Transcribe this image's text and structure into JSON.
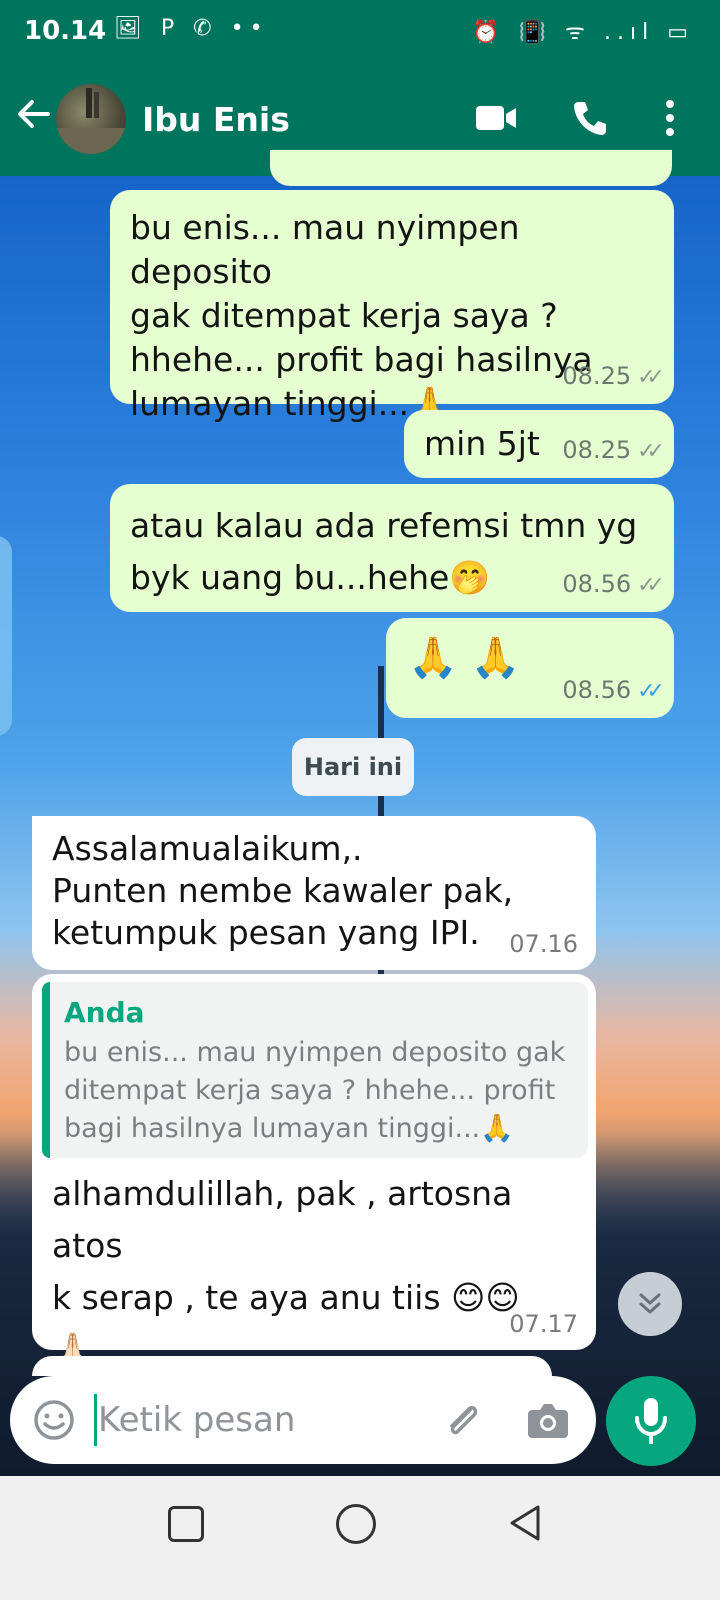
{
  "status_bar": {
    "time": "10.14",
    "left_icons": "🖼 P ✆ ••",
    "right_icons": "⏰ 📳 ᯤ ..ıl ▭"
  },
  "header": {
    "contact_name": "Ibu Enis",
    "icons": [
      "back-arrow-icon",
      "video-call-icon",
      "phone-call-icon",
      "more-vert-icon"
    ]
  },
  "messages": [
    {
      "direction": "out",
      "text": "bu enis... mau nyimpen deposito\ngak ditempat kerja saya ?\nhhehe... profit bagi hasilnya\nlumayan tinggi...🙏",
      "time": "08.25",
      "status": "delivered"
    },
    {
      "direction": "out",
      "text": "min 5jt",
      "time": "08.25",
      "status": "delivered"
    },
    {
      "direction": "out",
      "text": "atau kalau ada refemsi tmn yg\nbyk uang bu...hehe🤭",
      "time": "08.56",
      "status": "delivered"
    },
    {
      "direction": "out",
      "text": "🙏 🙏",
      "time": "08.56",
      "status": "read"
    },
    {
      "direction": "in",
      "text": "Assalamualaikum,.\nPunten nembe kawaler pak,\nketumpuk pesan yang IPI.",
      "time": "07.16"
    },
    {
      "direction": "in",
      "text": "alhamdulillah, pak , artosna atos\nk serap , te aya anu tiis 😊😊\n🙏🏻",
      "time": "07.17",
      "quote": {
        "author": "Anda",
        "text": "bu enis... mau nyimpen deposito gak ditempat kerja saya ? hhehe... profit bagi hasilnya lumayan tinggi...🙏"
      }
    }
  ],
  "date_divider": "Hari ini",
  "input": {
    "placeholder": "Ketik pesan"
  },
  "colors": {
    "header": "#00755e",
    "accent": "#06a77e",
    "outgoing_bubble": "#e6ffd0",
    "incoming_bubble": "#ffffff",
    "read_tick": "#3aa3e6"
  }
}
